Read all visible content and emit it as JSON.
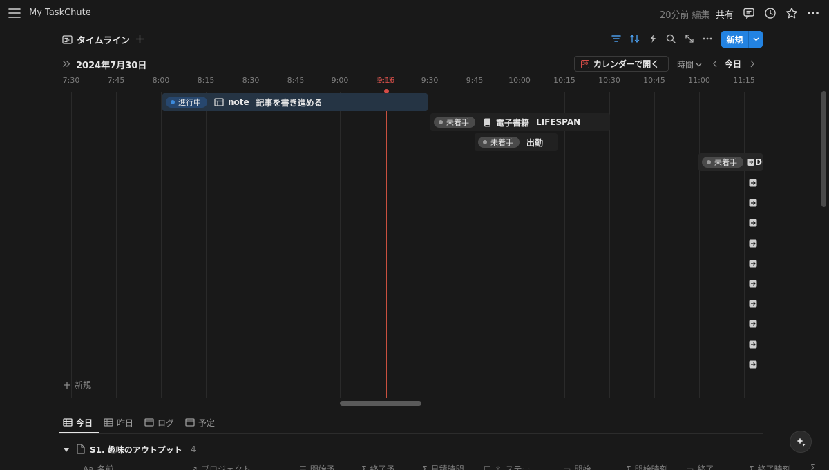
{
  "topbar": {
    "title": "My TaskChute",
    "edited": "20分前 編集",
    "share": "共有"
  },
  "view": {
    "tab_label": "タイムライン",
    "new_label": "新規"
  },
  "timeline": {
    "date": "2024年7月30日",
    "open_calendar": "カレンダーで開く",
    "calendar_icon_text": "30",
    "time_unit": "時間",
    "today": "今日",
    "now_marker": "9:16",
    "ticks": [
      "7:30",
      "7:45",
      "8:00",
      "8:15",
      "8:30",
      "8:45",
      "9:00",
      "9:15",
      "9:30",
      "9:45",
      "10:00",
      "10:15",
      "10:30",
      "10:45",
      "11:00",
      "11:15"
    ],
    "add_row": "新規"
  },
  "tasks": [
    {
      "status": "進行中",
      "project": "note",
      "name": "記事を書き進める",
      "status_color": "#3d8bdc"
    },
    {
      "status": "未着手",
      "project": "電子書籍",
      "name": "LIFESPAN",
      "status_color": "#9b9b9b"
    },
    {
      "status": "未着手",
      "name": "出勤",
      "status_color": "#9b9b9b"
    },
    {
      "status": "未着手",
      "name": "Du",
      "status_color": "#9b9b9b"
    }
  ],
  "bottom_tabs": [
    {
      "label": "今日",
      "active": true
    },
    {
      "label": "昨日",
      "active": false
    },
    {
      "label": "ログ",
      "active": false
    },
    {
      "label": "予定",
      "active": false
    }
  ],
  "group": {
    "title": "S1. 趣味のアウトプット",
    "count": "4"
  },
  "columns": [
    "名前",
    "プロジェクト",
    "開始予",
    "終了予",
    "見積時間",
    "ステー",
    "開始",
    "開始時刻",
    "終了",
    "終了時刻"
  ],
  "colors": {
    "accent": "#2383e2",
    "now_line": "#d44c47",
    "background": "#191919"
  }
}
